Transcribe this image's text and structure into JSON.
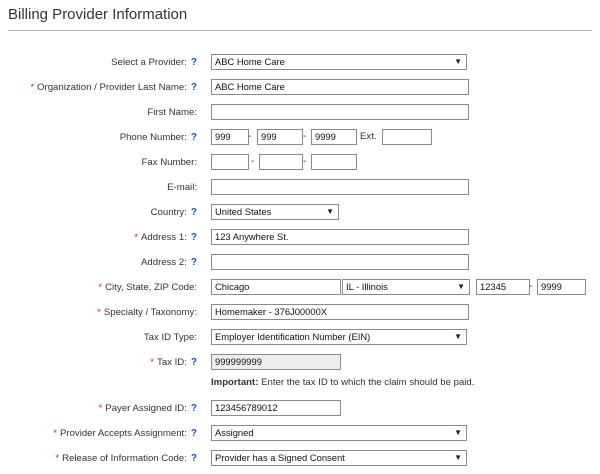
{
  "header": {
    "title": "Billing Provider Information"
  },
  "help_glyph": "?",
  "required_glyph": "*",
  "colors": {
    "required": "#d9251d",
    "help": "#1a4fc8"
  },
  "fields": {
    "select_provider": {
      "label": "Select a Provider:",
      "value": "ABC Home Care"
    },
    "org_last_name": {
      "label": "Organization / Provider Last Name:",
      "value": "ABC Home Care"
    },
    "first_name": {
      "label": "First Name:",
      "value": ""
    },
    "phone": {
      "label": "Phone Number:",
      "area": "999",
      "prefix": "999",
      "line": "9999",
      "ext_label": "Ext.",
      "ext": ""
    },
    "fax": {
      "label": "Fax Number:",
      "area": "",
      "prefix": "",
      "line": ""
    },
    "email": {
      "label": "E-mail:",
      "value": ""
    },
    "country": {
      "label": "Country:",
      "value": "United States"
    },
    "address1": {
      "label": "Address 1:",
      "value": "123 Anywhere St."
    },
    "address2": {
      "label": "Address 2:",
      "value": ""
    },
    "city_state_zip": {
      "label": "City, State, ZIP Code:",
      "city": "Chicago",
      "state": "IL - Illinois",
      "zip": "12345",
      "zip4": "9999"
    },
    "specialty": {
      "label": "Specialty / Taxonomy:",
      "value": "Homemaker - 376J00000X"
    },
    "tax_id_type": {
      "label": "Tax ID Type:",
      "value": "Employer Identification Number (EIN)"
    },
    "tax_id": {
      "label": "Tax ID:",
      "value": "999999999"
    },
    "tax_note": {
      "strong": "Important:",
      "text": " Enter the tax ID to which the claim should be paid."
    },
    "payer_assigned_id": {
      "label": "Payer Assigned ID:",
      "value": "123456789012"
    },
    "accepts_assignment": {
      "label": "Provider Accepts Assignment:",
      "value": "Assigned"
    },
    "release_info": {
      "label": "Release of Information Code:",
      "value": "Provider has a Signed Consent"
    }
  },
  "dash": "-"
}
